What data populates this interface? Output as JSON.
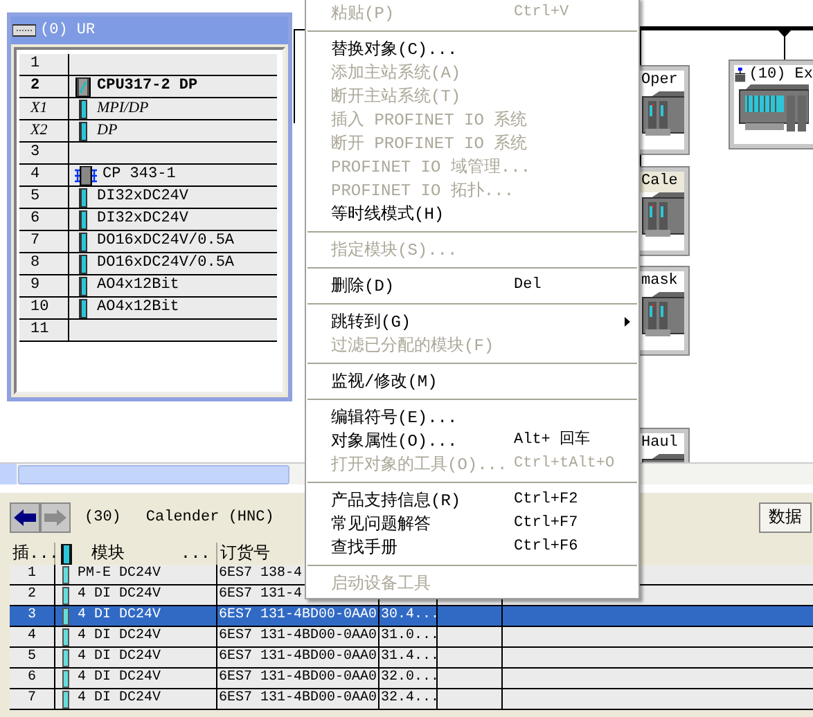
{
  "rack": {
    "title": "(0) UR",
    "rows": [
      {
        "slot": "1",
        "kind": "empty"
      },
      {
        "slot": "2",
        "module": "CPU317-2 DP",
        "kind": "cpu"
      },
      {
        "slot": "X1",
        "module": "MPI/DP",
        "kind": "interface"
      },
      {
        "slot": "X2",
        "module": "DP",
        "kind": "interface"
      },
      {
        "slot": "3",
        "kind": "empty"
      },
      {
        "slot": "4",
        "module": "CP 343-1",
        "kind": "cp"
      },
      {
        "slot": "5",
        "module": "DI32xDC24V",
        "kind": "module"
      },
      {
        "slot": "6",
        "module": "DI32xDC24V",
        "kind": "module"
      },
      {
        "slot": "7",
        "module": "DO16xDC24V/0.5A",
        "kind": "module"
      },
      {
        "slot": "8",
        "module": "DO16xDC24V/0.5A",
        "kind": "module"
      },
      {
        "slot": "9",
        "module": "AO4x12Bit",
        "kind": "module"
      },
      {
        "slot": "10",
        "module": "AO4x12Bit",
        "kind": "module"
      },
      {
        "slot": "11",
        "kind": "empty"
      }
    ]
  },
  "network": {
    "stations": [
      {
        "label": "Oper",
        "selected": false
      },
      {
        "label": "Cale",
        "selected": true
      },
      {
        "label": "mask",
        "selected": false
      },
      {
        "label": "Haul",
        "selected": false
      }
    ],
    "io_station": {
      "label": "(10) Ex"
    }
  },
  "context_menu": [
    {
      "kind": "item",
      "label": "粘贴(P)",
      "shortcut": "Ctrl+V",
      "disabled": true
    },
    {
      "kind": "separator"
    },
    {
      "kind": "item",
      "label": "替换对象(C)...",
      "disabled": false
    },
    {
      "kind": "item",
      "label": "添加主站系统(A)",
      "disabled": true
    },
    {
      "kind": "item",
      "label": "断开主站系统(T)",
      "disabled": true
    },
    {
      "kind": "item",
      "label": "插入 PROFINET IO 系统",
      "disabled": true
    },
    {
      "kind": "item",
      "label": "断开 PROFINET IO 系统",
      "disabled": true
    },
    {
      "kind": "item",
      "label": "PROFINET IO 域管理...",
      "disabled": true
    },
    {
      "kind": "item",
      "label": "PROFINET IO 拓扑...",
      "disabled": true
    },
    {
      "kind": "item",
      "label": "等时线模式(H)",
      "disabled": false
    },
    {
      "kind": "separator"
    },
    {
      "kind": "item",
      "label": "指定模块(S)...",
      "disabled": true
    },
    {
      "kind": "separator"
    },
    {
      "kind": "item",
      "label": "删除(D)",
      "shortcut": "Del",
      "disabled": false
    },
    {
      "kind": "separator"
    },
    {
      "kind": "item",
      "label": "跳转到(G)",
      "disabled": false,
      "submenu": true
    },
    {
      "kind": "item",
      "label": "过滤已分配的模块(F)",
      "disabled": true
    },
    {
      "kind": "separator"
    },
    {
      "kind": "item",
      "label": "监视/修改(M)",
      "disabled": false
    },
    {
      "kind": "separator"
    },
    {
      "kind": "item",
      "label": "编辑符号(E)...",
      "disabled": false
    },
    {
      "kind": "item",
      "label": "对象属性(O)...",
      "shortcut": "Alt+ 回车",
      "disabled": false
    },
    {
      "kind": "item",
      "label": "打开对象的工具(O)...",
      "shortcut": "Ctrl+tAlt+O",
      "disabled": true
    },
    {
      "kind": "separator"
    },
    {
      "kind": "item",
      "label": "产品支持信息(R)",
      "shortcut": "Ctrl+F2",
      "disabled": false
    },
    {
      "kind": "item",
      "label": "常见问题解答",
      "shortcut": "Ctrl+F7",
      "disabled": false
    },
    {
      "kind": "item",
      "label": "查找手册",
      "shortcut": "Ctrl+F6",
      "disabled": false
    },
    {
      "kind": "separator"
    },
    {
      "kind": "item",
      "label": "启动设备工具",
      "disabled": true
    }
  ],
  "detail": {
    "back_disabled": false,
    "forward_disabled": true,
    "number": "(30)",
    "name": "Calender (HNC)",
    "data_button": "数据",
    "columns": [
      "插...",
      "模块",
      "...",
      "订货号"
    ],
    "rows": [
      {
        "slot": "1",
        "module": "PM-E DC24V",
        "order": "6ES7 138-4",
        "selected": false
      },
      {
        "slot": "2",
        "module": "4 DI DC24V",
        "order": "6ES7 131-4",
        "selected": false
      },
      {
        "slot": "3",
        "module": "4 DI DC24V",
        "order": "6ES7 131-4BD00-0AA0",
        "column_4": "30.4...",
        "selected": true
      },
      {
        "slot": "4",
        "module": "4 DI DC24V",
        "order": "6ES7 131-4BD00-0AA0",
        "column_4": "31.0...",
        "selected": false
      },
      {
        "slot": "5",
        "module": "4 DI DC24V",
        "order": "6ES7 131-4BD00-0AA0",
        "column_4": "31.4...",
        "selected": false
      },
      {
        "slot": "6",
        "module": "4 DI DC24V",
        "order": "6ES7 131-4BD00-0AA0",
        "column_4": "32.0...",
        "selected": false
      },
      {
        "slot": "7",
        "module": "4 DI DC24V",
        "order": "6ES7 131-4BD00-0AA0",
        "column_4": "32.4...",
        "selected": false
      }
    ]
  }
}
